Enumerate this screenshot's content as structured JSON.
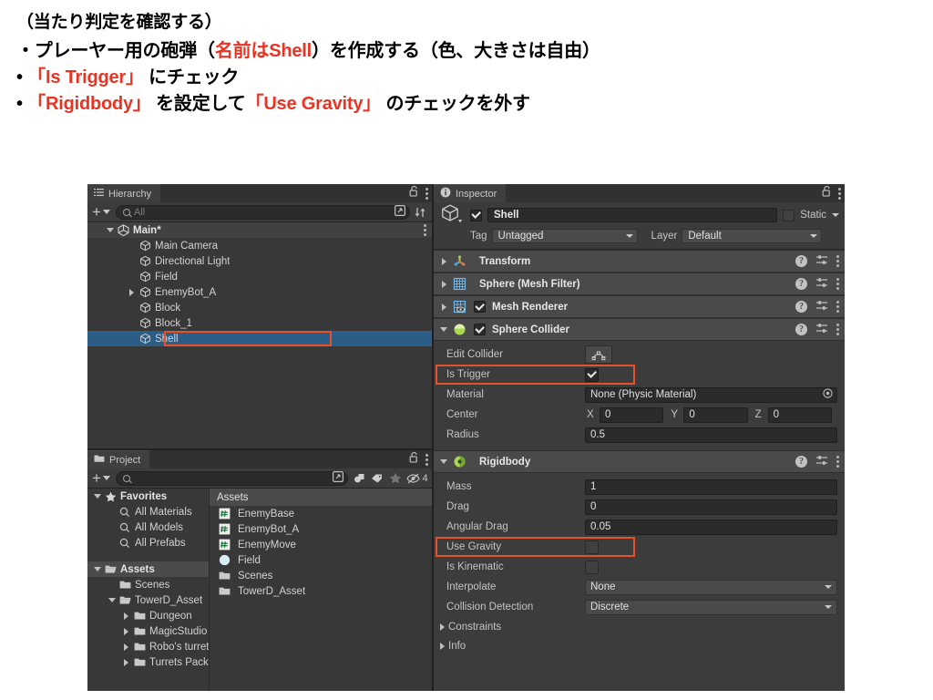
{
  "instructions": {
    "lines": [
      {
        "segments": [
          {
            "text": "（当たり判定を確認する）",
            "color": "black"
          }
        ]
      },
      {
        "segments": [
          {
            "text": "・プレーヤー用の砲弾（",
            "color": "black"
          },
          {
            "text": "名前はShell",
            "color": "red"
          },
          {
            "text": "）を作成する（色、大きさは自由）",
            "color": "black"
          }
        ]
      },
      {
        "segments": [
          {
            "text": "• ",
            "color": "black"
          },
          {
            "text": "「Is Trigger」",
            "color": "red"
          },
          {
            "text": " にチェック",
            "color": "black"
          }
        ]
      },
      {
        "segments": [
          {
            "text": "• ",
            "color": "black"
          },
          {
            "text": "「Rigidbody」",
            "color": "red"
          },
          {
            "text": " を設定して",
            "color": "black"
          },
          {
            "text": "「Use Gravity」",
            "color": "red"
          },
          {
            "text": " のチェックを外す",
            "color": "black"
          }
        ]
      }
    ],
    "accent_red": "#ea3323"
  },
  "hierarchy": {
    "tab_label": "Hierarchy",
    "tab_icon": "hierarchy-icon",
    "lock_icon": "lock-open-icon",
    "menu_icon": "kebab-menu-icon",
    "add_label": "+",
    "search_placeholder": "All",
    "toolbar_icons": [
      "search-by-type-icon",
      "sort-icon"
    ],
    "items": [
      {
        "label": "Main*",
        "indent": 0,
        "twisty": "down",
        "icon": "unity-scene-icon",
        "bold": true,
        "selected": false,
        "row_type": "scene"
      },
      {
        "label": "Main Camera",
        "indent": 1,
        "twisty": "none",
        "icon": "gameobject-cube-icon",
        "bold": false,
        "selected": false
      },
      {
        "label": "Directional Light",
        "indent": 1,
        "twisty": "none",
        "icon": "gameobject-cube-icon",
        "bold": false,
        "selected": false
      },
      {
        "label": "Field",
        "indent": 1,
        "twisty": "none",
        "icon": "gameobject-cube-icon",
        "bold": false,
        "selected": false
      },
      {
        "label": "EnemyBot_A",
        "indent": 1,
        "twisty": "right",
        "icon": "gameobject-cube-icon",
        "bold": false,
        "selected": false
      },
      {
        "label": "Block",
        "indent": 1,
        "twisty": "none",
        "icon": "gameobject-cube-icon",
        "bold": false,
        "selected": false
      },
      {
        "label": "Block_1",
        "indent": 1,
        "twisty": "none",
        "icon": "gameobject-cube-icon",
        "bold": false,
        "selected": false
      },
      {
        "label": "Shell",
        "indent": 1,
        "twisty": "none",
        "icon": "gameobject-cube-icon",
        "bold": false,
        "selected": true,
        "highlighted": true
      }
    ]
  },
  "project": {
    "tab_label": "Project",
    "tab_icon": "folder-icon",
    "lock_icon": "lock-open-icon",
    "menu_icon": "kebab-menu-icon",
    "add_label": "+",
    "search_placeholder": "",
    "toolbar_icons": [
      "search-by-type-icon",
      "search-by-label-icon",
      "favorites-star-icon",
      "hidden-packages-icon"
    ],
    "hidden_count": "4",
    "tree": [
      {
        "label": "Favorites",
        "indent": 0,
        "twisty": "down",
        "icon": "star-icon",
        "bold": true,
        "selected": false
      },
      {
        "label": "All Materials",
        "indent": 1,
        "twisty": "none",
        "icon": "search-icon",
        "bold": false,
        "selected": false
      },
      {
        "label": "All Models",
        "indent": 1,
        "twisty": "none",
        "icon": "search-icon",
        "bold": false,
        "selected": false
      },
      {
        "label": "All Prefabs",
        "indent": 1,
        "twisty": "none",
        "icon": "search-icon",
        "bold": false,
        "selected": false
      },
      {
        "label": "",
        "indent": 0,
        "twisty": "none",
        "icon": "none",
        "spacer": true
      },
      {
        "label": "Assets",
        "indent": 0,
        "twisty": "down",
        "icon": "folder-open-icon",
        "bold": true,
        "selected": true
      },
      {
        "label": "Scenes",
        "indent": 1,
        "twisty": "none",
        "icon": "folder-icon",
        "bold": false,
        "selected": false
      },
      {
        "label": "TowerD_Asset",
        "indent": 1,
        "twisty": "down",
        "icon": "folder-open-icon",
        "bold": false,
        "selected": false
      },
      {
        "label": "Dungeon",
        "indent": 2,
        "twisty": "right",
        "icon": "folder-icon",
        "bold": false,
        "selected": false
      },
      {
        "label": "MagicStudio",
        "indent": 2,
        "twisty": "right",
        "icon": "folder-icon",
        "bold": false,
        "selected": false
      },
      {
        "label": "Robo's turret",
        "indent": 2,
        "twisty": "right",
        "icon": "folder-icon",
        "bold": false,
        "selected": false
      },
      {
        "label": "Turrets Pack",
        "indent": 2,
        "twisty": "right",
        "icon": "folder-icon",
        "bold": false,
        "selected": false
      }
    ],
    "content_header": "Assets",
    "assets": [
      {
        "label": "EnemyBase",
        "icon": "csharp-script-icon"
      },
      {
        "label": "EnemyBot_A",
        "icon": "csharp-script-icon"
      },
      {
        "label": "EnemyMove",
        "icon": "csharp-script-icon"
      },
      {
        "label": "Field",
        "icon": "prefab-icon"
      },
      {
        "label": "Scenes",
        "icon": "folder-icon"
      },
      {
        "label": "TowerD_Asset",
        "icon": "folder-icon"
      }
    ]
  },
  "inspector": {
    "tab_label": "Inspector",
    "tab_icon": "info-icon",
    "lock_icon": "lock-open-icon",
    "menu_icon": "kebab-menu-icon",
    "object": {
      "icon": "gameobject-cube-icon",
      "enabled": true,
      "name": "Shell",
      "static_label": "Static",
      "static_checked": false,
      "tag_label": "Tag",
      "tag_value": "Untagged",
      "layer_label": "Layer",
      "layer_value": "Default"
    },
    "components": [
      {
        "name": "Transform",
        "icon": "transform-axis-icon",
        "expanded": false,
        "has_enable_checkbox": false
      },
      {
        "name": "Sphere (Mesh Filter)",
        "icon": "mesh-filter-icon",
        "expanded": false,
        "has_enable_checkbox": false
      },
      {
        "name": "Mesh Renderer",
        "icon": "mesh-renderer-icon",
        "expanded": false,
        "has_enable_checkbox": true,
        "enabled": true
      },
      {
        "name": "Sphere Collider",
        "icon": "sphere-collider-icon",
        "expanded": true,
        "has_enable_checkbox": true,
        "enabled": true,
        "properties": [
          {
            "label": "Edit Collider",
            "type": "button",
            "icon": "edit-collider-icon"
          },
          {
            "label": "Is Trigger",
            "type": "checkbox",
            "value": true,
            "highlighted": true
          },
          {
            "label": "Material",
            "type": "object-field",
            "value": "None (Physic Material)"
          },
          {
            "label": "Center",
            "type": "vector3",
            "x": "0",
            "y": "0",
            "z": "0"
          },
          {
            "label": "Radius",
            "type": "text",
            "value": "0.5"
          }
        ]
      },
      {
        "name": "Rigidbody",
        "icon": "rigidbody-icon",
        "expanded": true,
        "has_enable_checkbox": false,
        "properties": [
          {
            "label": "Mass",
            "type": "text",
            "value": "1"
          },
          {
            "label": "Drag",
            "type": "text",
            "value": "0"
          },
          {
            "label": "Angular Drag",
            "type": "text",
            "value": "0.05"
          },
          {
            "label": "Use Gravity",
            "type": "checkbox",
            "value": false,
            "highlighted": true
          },
          {
            "label": "Is Kinematic",
            "type": "checkbox",
            "value": false
          },
          {
            "label": "Interpolate",
            "type": "dropdown",
            "value": "None"
          },
          {
            "label": "Collision Detection",
            "type": "dropdown",
            "value": "Discrete"
          },
          {
            "label": "Constraints",
            "type": "foldout"
          },
          {
            "label": "Info",
            "type": "foldout"
          }
        ]
      }
    ],
    "header_icons": [
      "help-icon",
      "preset-icon",
      "kebab-menu-icon"
    ]
  },
  "colors": {
    "accent_red": "#ea3323",
    "highlight_box": "#e8502a",
    "selection_blue": "#2c5d87",
    "panel_bg": "#383838",
    "comp_header": "#4a4a4a"
  }
}
